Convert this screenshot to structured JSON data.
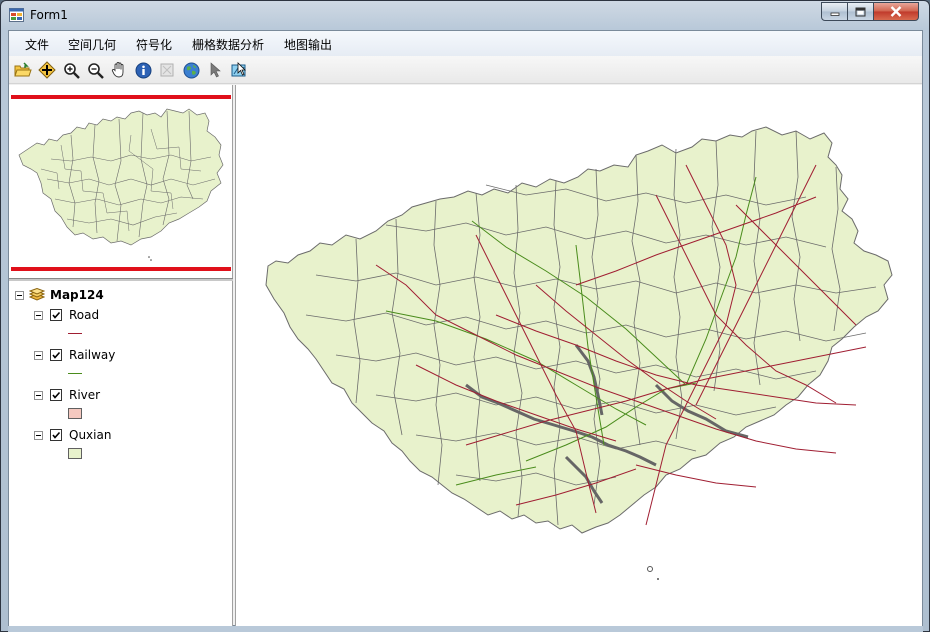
{
  "window": {
    "title": "Form1",
    "controls": {
      "minimize": "minimize",
      "maximize": "maximize",
      "close": "close"
    }
  },
  "menu": {
    "items": [
      {
        "label": "文件"
      },
      {
        "label": "空间几何"
      },
      {
        "label": "符号化"
      },
      {
        "label": "栅格数据分析"
      },
      {
        "label": "地图输出"
      }
    ]
  },
  "toolbar": {
    "tools": [
      {
        "icon": "open-folder-icon"
      },
      {
        "icon": "add-data-icon"
      },
      {
        "icon": "zoom-in-icon"
      },
      {
        "icon": "zoom-out-icon"
      },
      {
        "icon": "pan-hand-icon"
      },
      {
        "icon": "identify-icon"
      },
      {
        "icon": "disabled-tool-icon"
      },
      {
        "icon": "full-extent-globe-icon"
      },
      {
        "icon": "select-arrow-icon"
      },
      {
        "icon": "select-features-icon"
      }
    ]
  },
  "toc": {
    "map_name": "Map124",
    "layers": [
      {
        "name": "Road",
        "checked": true,
        "symbol": "line",
        "color": "#a01e32"
      },
      {
        "name": "Railway",
        "checked": true,
        "symbol": "line",
        "color": "#4a8c1c"
      },
      {
        "name": "River",
        "checked": true,
        "symbol": "fill",
        "color": "#f5c9c0"
      },
      {
        "name": "Quxian",
        "checked": true,
        "symbol": "fill",
        "color": "#e8f2cc"
      }
    ]
  },
  "colors": {
    "overview_extent": "#e0101a",
    "county_fill": "#e8f2cc",
    "county_border": "#6b6b6b",
    "road": "#a01e32",
    "railway": "#4a8c1c"
  }
}
